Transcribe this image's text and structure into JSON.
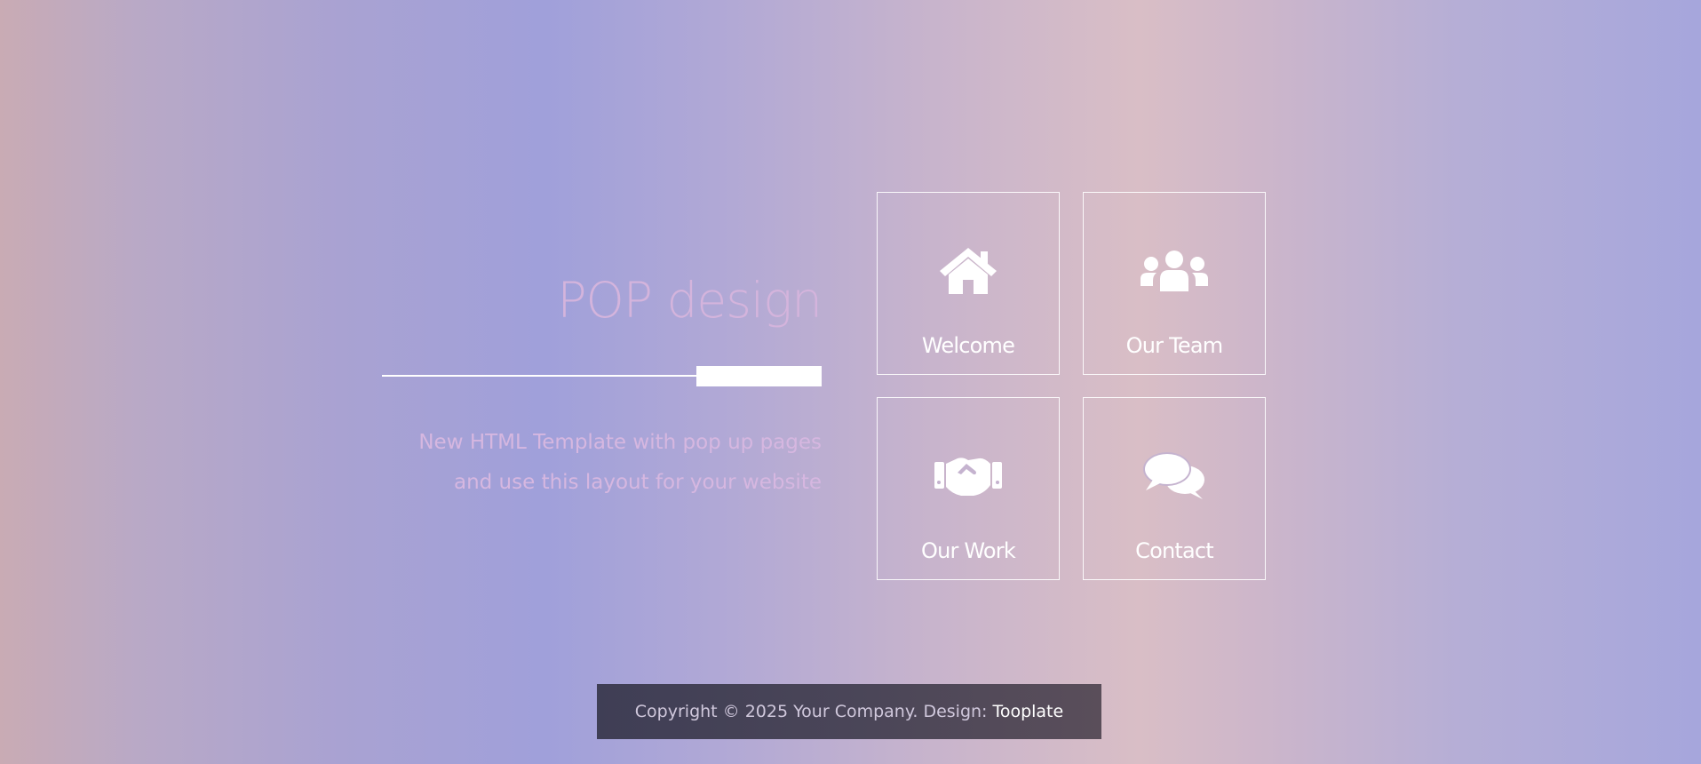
{
  "brand": {
    "title": "POP design",
    "tagline_line1": "New HTML Template with pop up pages",
    "tagline_line2": "and use this layout for your website"
  },
  "tiles": [
    {
      "label": "Welcome",
      "icon": "home-icon"
    },
    {
      "label": "Our Team",
      "icon": "users-icon"
    },
    {
      "label": "Our Work",
      "icon": "handshake-icon"
    },
    {
      "label": "Contact",
      "icon": "comments-icon"
    }
  ],
  "footer": {
    "copyright": "Copyright © 2025 Your Company. Design:",
    "link_label": "Tooplate"
  },
  "colors": {
    "accent_text": "#d4b4dc",
    "tile_border": "#ffffff",
    "footer_bg": "#45415a"
  }
}
